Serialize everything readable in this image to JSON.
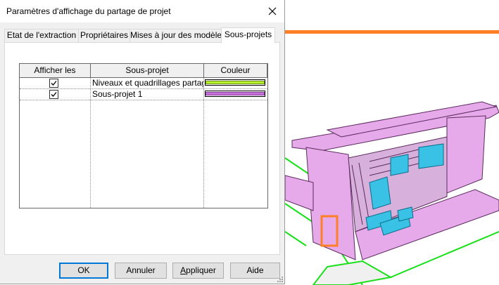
{
  "dialog": {
    "title": "Paramètres d'affichage du partage de projet",
    "close_icon": "close-icon"
  },
  "tabs": [
    {
      "label": "Etat de l'extraction",
      "active": false
    },
    {
      "label": "Propriétaires",
      "active": false
    },
    {
      "label": "Mises à jour des modèles",
      "active": false
    },
    {
      "label": "Sous-projets",
      "active": true
    }
  ],
  "grid": {
    "columns": [
      "Afficher les",
      "Sous-projet",
      "Couleur"
    ],
    "rows": [
      {
        "checked": true,
        "name": "Niveaux et quadrillages partag",
        "color": "#b6f22c",
        "border": "#6d8f16"
      },
      {
        "checked": true,
        "name": "Sous-projet 1",
        "color": "#c76fd9",
        "border": "#8d3fa0"
      }
    ]
  },
  "buttons": {
    "ok": "OK",
    "cancel": "Annuler",
    "apply_pre": "",
    "apply_mnemonic": "A",
    "apply_post": "ppliquer",
    "help": "Aide"
  },
  "viewport": {
    "building_color": "#e6a9ea",
    "furniture_color": "#39c1e6",
    "edge_color": "#ff7f27",
    "grid_line_color": "#19e019"
  }
}
